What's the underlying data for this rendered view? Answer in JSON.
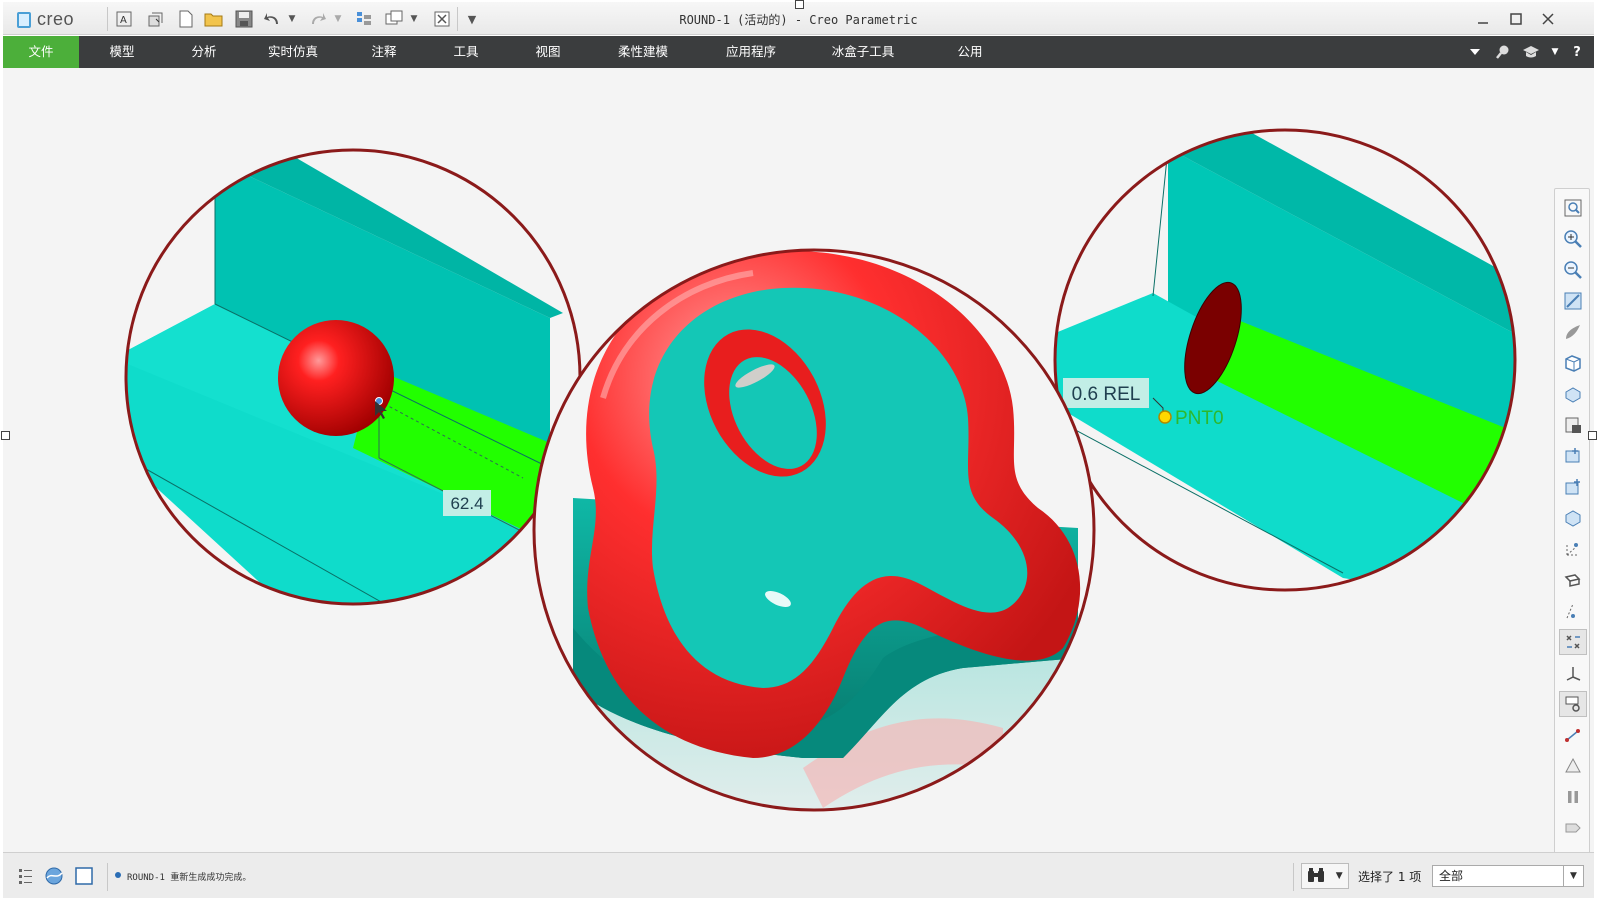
{
  "titlebar": {
    "logo_text": "creo",
    "title": "ROUND-1 (活动的) - Creo Parametric",
    "quick_access_icons": [
      "font-icon",
      "regenerate-icon",
      "new-file-icon",
      "open-folder-icon",
      "save-icon",
      "undo-icon",
      "dropdown-icon",
      "redo-icon",
      "dropdown-icon",
      "manager-icon",
      "windows-icon",
      "dropdown-icon",
      "close-window-icon",
      "customize-icon"
    ],
    "window_buttons": [
      "minimize-icon",
      "maximize-icon",
      "close-icon"
    ]
  },
  "ribbon": {
    "tabs": [
      {
        "label": "文件",
        "active": true
      },
      {
        "label": "模型",
        "active": false
      },
      {
        "label": "分析",
        "active": false
      },
      {
        "label": "实时仿真",
        "active": false
      },
      {
        "label": "注释",
        "active": false
      },
      {
        "label": "工具",
        "active": false
      },
      {
        "label": "视图",
        "active": false
      },
      {
        "label": "柔性建模",
        "active": false
      },
      {
        "label": "应用程序",
        "active": false
      },
      {
        "label": "冰盒子工具",
        "active": false
      },
      {
        "label": "公用",
        "active": false
      }
    ],
    "right_icons": [
      "collapse-ribbon-icon",
      "search-icon",
      "learning-icon",
      "dropdown-icon",
      "help-icon"
    ],
    "accent_color": "#4caf3a"
  },
  "viewport": {
    "left_detail": {
      "dimension_value": "62.4"
    },
    "right_detail": {
      "parameter_label": "0.6 REL",
      "point_label": "PNT0"
    },
    "colors": {
      "surface_cyan": "#00d9c8",
      "round_red": "#ff2a2a",
      "highlight_green": "#22ff00",
      "callout_ring": "#8b1a1a",
      "body_teal": "#0a9e8e"
    }
  },
  "graphics_toolbar": {
    "icons": [
      "refit-icon",
      "zoom-in-icon",
      "zoom-out-icon",
      "repaint-icon",
      "display-style-icon",
      "saved-orientations-icon",
      "view-manager-icon",
      "perspective-icon",
      "plane-display-icon",
      "axis-display-icon",
      "point-display-icon",
      "csys-display-icon",
      "spin-center-icon",
      "annotation-display-icon",
      "datum-plane-icon",
      "datum-axis-icon",
      "datum-point-icon",
      "csys-icon",
      "sketch-icon",
      "curve-icon",
      "pause-icon",
      "next-icon"
    ]
  },
  "statusbar": {
    "message": "ROUND-1 重新生成成功完成。",
    "selection_count": "选择了 1 项",
    "filter_value": "全部",
    "left_icons": [
      "model-tree-icon",
      "browser-icon",
      "graphics-window-icon"
    ],
    "find_icon": "binoculars-icon"
  }
}
